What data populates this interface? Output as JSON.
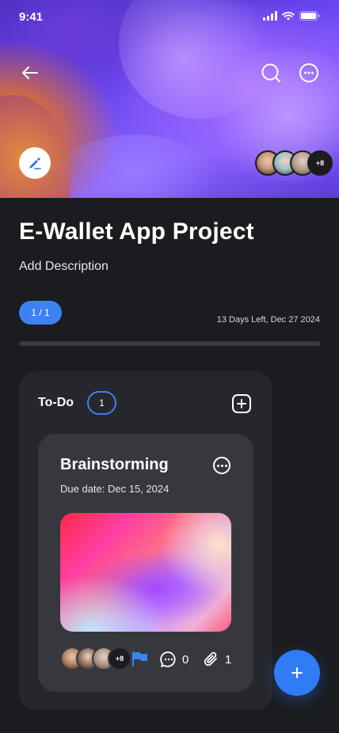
{
  "status": {
    "time": "9:41"
  },
  "project": {
    "title": "E-Wallet App Project",
    "description": "Add Description",
    "progress_label": "1 / 1",
    "progress_fraction": 0,
    "deadline": "13 Days Left, Dec 27 2024",
    "members_more": "+8"
  },
  "column": {
    "title": "To-Do",
    "count": "1"
  },
  "card": {
    "title": "Brainstorming",
    "due": "Due date: Dec 15, 2024",
    "members_more": "+8",
    "comments": "0",
    "attachments": "1"
  },
  "colors": {
    "accent": "#3d82f3",
    "background": "#1b1c20",
    "column": "#26272c",
    "card": "#37383d"
  },
  "icons": {
    "back": "arrow-left-icon",
    "search": "search-icon",
    "more": "more-horizontal-icon",
    "edit": "pencil-icon",
    "add": "plus-icon",
    "flag": "flag-icon",
    "comment": "comment-icon",
    "attachment": "paperclip-icon"
  }
}
